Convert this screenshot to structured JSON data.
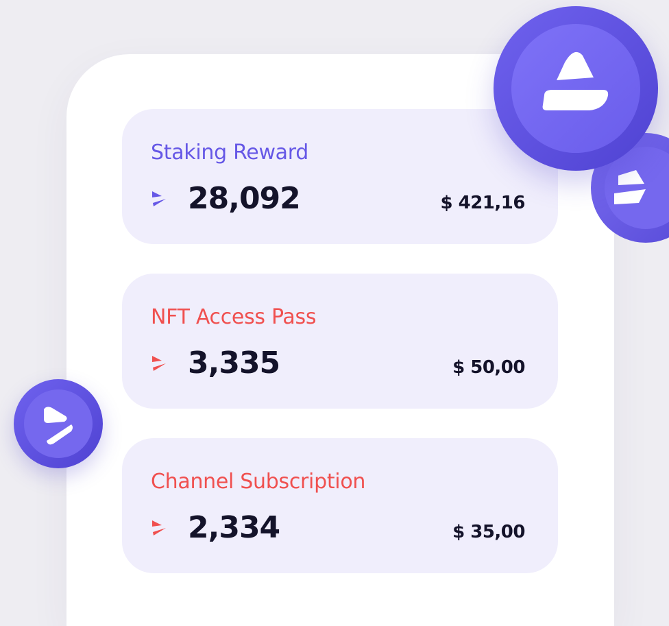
{
  "colors": {
    "background": "#EEEDF2",
    "panel": "#FFFFFF",
    "card": "#F0EEFC",
    "purple_accent": "#6658E6",
    "red_accent": "#F0504F",
    "amount_text": "#14132A"
  },
  "cards": [
    {
      "label": "Staking Reward",
      "amount": "28,092",
      "usd": "$ 421,16",
      "accent": "#6658E6",
      "icon": "purple-token-icon"
    },
    {
      "label": "NFT Access Pass",
      "amount": "3,335",
      "usd": "$ 50,00",
      "accent": "#F0504F",
      "icon": "red-token-icon"
    },
    {
      "label": "Channel Subscription",
      "amount": "2,334",
      "usd": "$ 35,00",
      "accent": "#F0504F",
      "icon": "red-token-icon"
    }
  ],
  "decorations": {
    "coins": [
      "large-token-coin-icon",
      "back-token-coin-icon",
      "small-token-coin-icon"
    ]
  }
}
